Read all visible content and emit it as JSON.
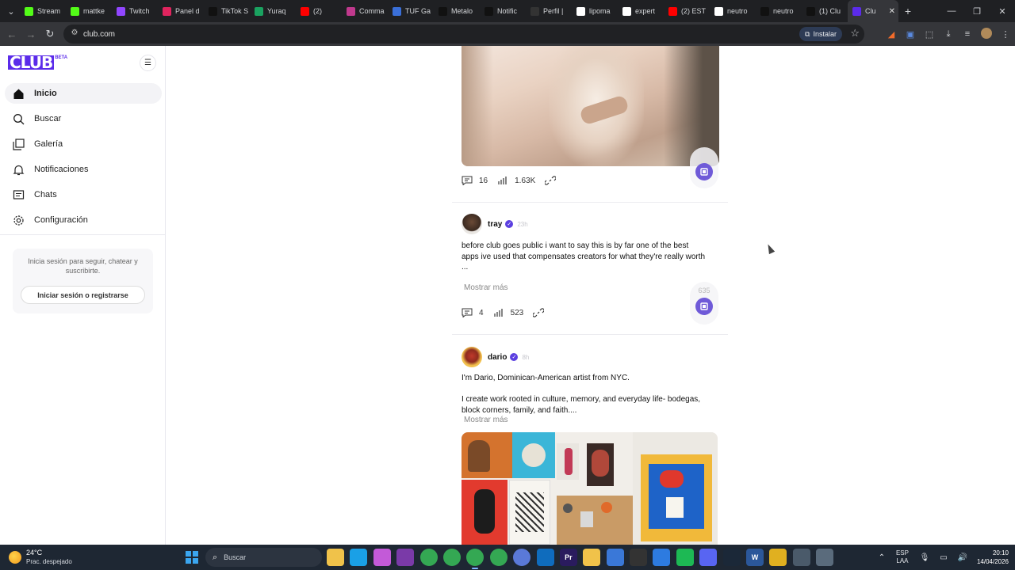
{
  "browser": {
    "tabs": [
      {
        "label": "Stream",
        "icon": "kick-icon",
        "color": "#53fc18"
      },
      {
        "label": "mattke",
        "icon": "kick-icon",
        "color": "#53fc18"
      },
      {
        "label": "Twitch",
        "icon": "twitch-icon",
        "color": "#9146ff"
      },
      {
        "label": "Panel d",
        "icon": "panel-icon",
        "color": "#e0245e"
      },
      {
        "label": "TikTok S",
        "icon": "tiktok-icon",
        "color": "#111111"
      },
      {
        "label": "Yuraq",
        "icon": "yuraq-icon",
        "color": "#1aa260"
      },
      {
        "label": "(2)",
        "icon": "youtube-icon",
        "color": "#ff0000"
      },
      {
        "label": "Comma",
        "icon": "comma-icon",
        "color": "#c0398d"
      },
      {
        "label": "TUF Ga",
        "icon": "tuf-icon",
        "color": "#3a6fd8"
      },
      {
        "label": "Metalo",
        "icon": "x-icon",
        "color": "#111111"
      },
      {
        "label": "Notific",
        "icon": "x-icon",
        "color": "#111111"
      },
      {
        "label": "Perfil |",
        "icon": "perfil-icon",
        "color": "#333333"
      },
      {
        "label": "lipoma",
        "icon": "google-icon",
        "color": "#ffffff"
      },
      {
        "label": "expert",
        "icon": "google-icon",
        "color": "#ffffff"
      },
      {
        "label": "(2) EST",
        "icon": "youtube-icon",
        "color": "#ff0000"
      },
      {
        "label": "neutro",
        "icon": "google-icon",
        "color": "#ffffff"
      },
      {
        "label": "neutro",
        "icon": "x-icon",
        "color": "#111111"
      },
      {
        "label": "(1) Clu",
        "icon": "x-icon",
        "color": "#111111"
      },
      {
        "label": "Clu",
        "icon": "club-icon",
        "color": "#5b2bea",
        "active": true
      }
    ],
    "url": "club.com",
    "install_label": "Instalar"
  },
  "sidebar": {
    "logo_text": "CLUB",
    "logo_badge": "BETA",
    "nav": [
      {
        "label": "Inicio",
        "icon": "home-icon",
        "active": true
      },
      {
        "label": "Buscar",
        "icon": "search-icon"
      },
      {
        "label": "Galería",
        "icon": "gallery-icon"
      },
      {
        "label": "Notificaciones",
        "icon": "bell-icon"
      },
      {
        "label": "Chats",
        "icon": "chat-icon"
      },
      {
        "label": "Configuración",
        "icon": "gear-icon"
      }
    ],
    "login_prompt": "Inicia sesión para seguir, chatear y suscribirte.",
    "login_button": "Iniciar sesión o registrarse"
  },
  "feed": {
    "post1": {
      "comments": "16",
      "views": "1.63K"
    },
    "post2": {
      "author": "tray",
      "time": "23h",
      "text": "before club goes public i want to say this is by far one of the best apps ive used that compensates creators for what they're really worth",
      "ellipsis": "...",
      "more_label": "Mostrar más",
      "comments": "4",
      "views": "523",
      "badge_count": "635"
    },
    "post3": {
      "author": "dario",
      "time": "8h",
      "text_line1": "I'm Dario, Dominican-American artist from NYC.",
      "text_line2": "I create work rooted in culture, memory, and everyday life- bodegas, block corners, family, and faith....",
      "more_label": "Mostrar más"
    },
    "accent_color": "#5b2bea"
  },
  "taskbar": {
    "temperature": "24°C",
    "weather": "Prac. despejado",
    "search_label": "Buscar",
    "language_line1": "ESP",
    "language_line2": "LAA",
    "time": "20:10",
    "date": "14/04/2026",
    "apps": [
      {
        "icon": "file-explorer-icon",
        "color": "#f0c24a"
      },
      {
        "icon": "edge-icon",
        "color": "#1aa0e6"
      },
      {
        "icon": "copilot-icon",
        "color": "#c35ad8"
      },
      {
        "icon": "notepad-icon",
        "color": "#7a3aa8"
      },
      {
        "icon": "chrome-icon",
        "color": "#34a853"
      },
      {
        "icon": "chrome-icon",
        "color": "#34a853"
      },
      {
        "icon": "chrome-icon",
        "color": "#34a853",
        "active": true
      },
      {
        "icon": "chrome-icon",
        "color": "#34a853"
      },
      {
        "icon": "chrome-icon",
        "color": "#5a79d8"
      },
      {
        "icon": "outlook-icon",
        "color": "#0f6cbd"
      },
      {
        "icon": "premiere-icon",
        "color": "#2a1b5e",
        "label": "Pr"
      },
      {
        "icon": "folder-icon",
        "color": "#f0c24a"
      },
      {
        "icon": "store-icon",
        "color": "#3a78d8"
      },
      {
        "icon": "obs-icon",
        "color": "#333333"
      },
      {
        "icon": "sourcetree-icon",
        "color": "#2d7be0"
      },
      {
        "icon": "spotify-icon",
        "color": "#1db954"
      },
      {
        "icon": "discord-icon",
        "color": "#5865f2"
      },
      {
        "icon": "steam-icon",
        "color": "#1b2838"
      },
      {
        "icon": "word-icon",
        "color": "#2b579a",
        "label": "W"
      },
      {
        "icon": "notes-icon",
        "color": "#e0b020"
      },
      {
        "icon": "settings-icon",
        "color": "#4a5a6a"
      },
      {
        "icon": "calculator-icon",
        "color": "#5a6b7c"
      }
    ]
  }
}
